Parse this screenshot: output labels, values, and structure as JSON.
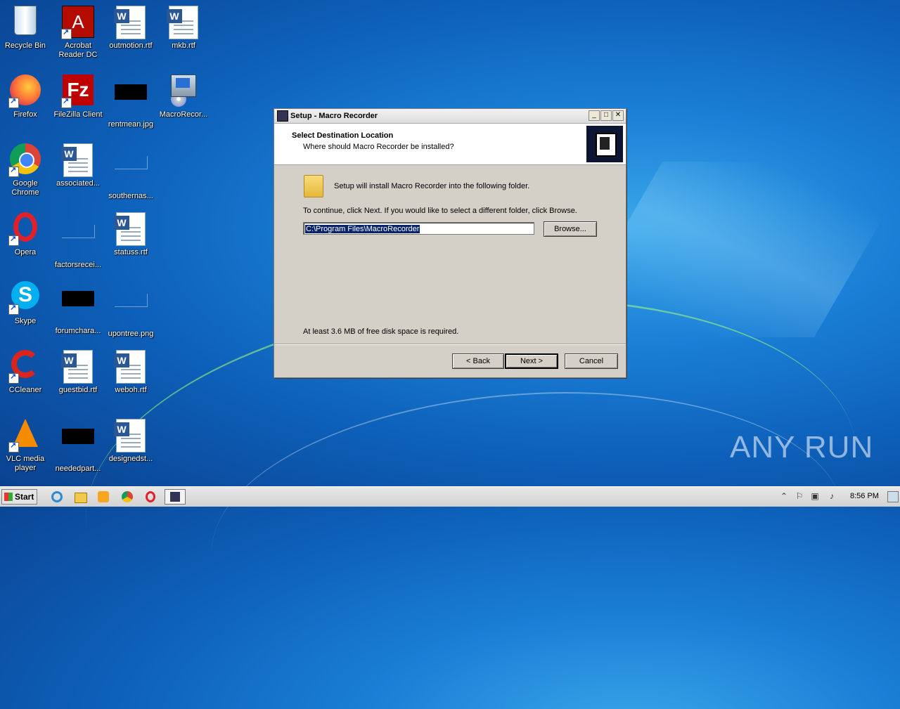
{
  "desktop": {
    "icons": [
      {
        "label": "Recycle Bin"
      },
      {
        "label": "Acrobat Reader DC"
      },
      {
        "label": "outmotion.rtf"
      },
      {
        "label": "mkb.rtf"
      },
      {
        "label": "Firefox"
      },
      {
        "label": "FileZilla Client"
      },
      {
        "label": "rentmean.jpg"
      },
      {
        "label": "MacroRecor..."
      },
      {
        "label": "Google Chrome"
      },
      {
        "label": "associated..."
      },
      {
        "label": "southernas..."
      },
      {
        "label": "Opera"
      },
      {
        "label": "factorsrecei..."
      },
      {
        "label": "statuss.rtf"
      },
      {
        "label": "Skype"
      },
      {
        "label": "forumchara..."
      },
      {
        "label": "upontree.png"
      },
      {
        "label": "CCleaner"
      },
      {
        "label": "guestbid.rtf"
      },
      {
        "label": "weboh.rtf"
      },
      {
        "label": "VLC media player"
      },
      {
        "label": "neededpart..."
      },
      {
        "label": "designedst..."
      }
    ]
  },
  "window": {
    "title": "Setup - Macro Recorder",
    "header_title": "Select Destination Location",
    "header_subtitle": "Where should Macro Recorder be installed?",
    "install_text": "Setup will install Macro Recorder into the following folder.",
    "continue_text": "To continue, click Next. If you would like to select a different folder, click Browse.",
    "path_value": "C:\\Program Files\\MacroRecorder",
    "browse_label": "Browse...",
    "disk_space_text": "At least 3.6 MB of free disk space is required.",
    "back_label": "< Back",
    "next_label": "Next >",
    "cancel_label": "Cancel",
    "title_buttons": [
      "_",
      "□",
      "✕"
    ]
  },
  "taskbar": {
    "start_label": "Start",
    "clock": "8:56 PM"
  },
  "watermark": "ANY RUN"
}
